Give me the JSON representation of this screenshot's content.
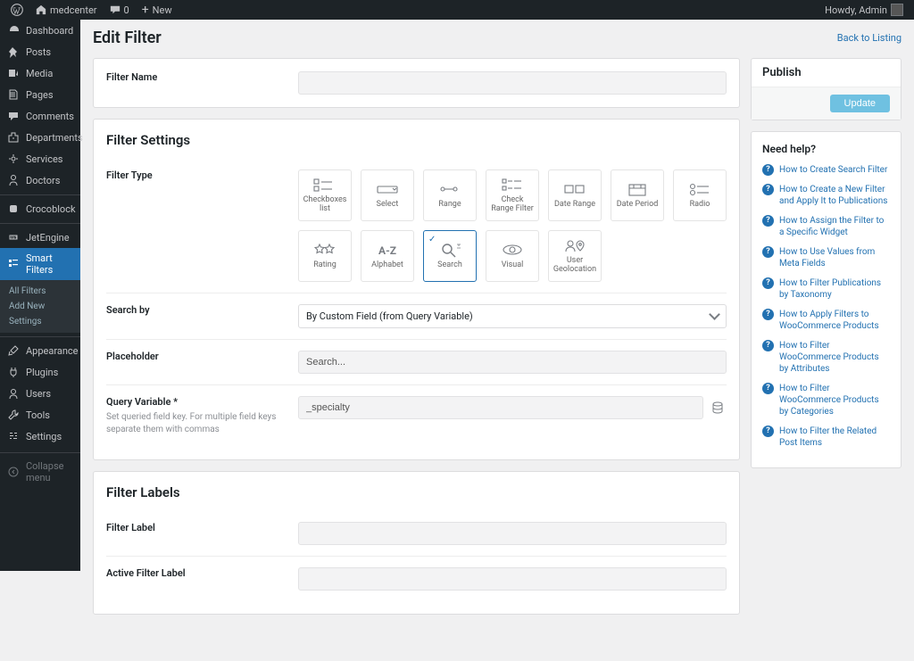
{
  "adminbar": {
    "site_name": "medcenter",
    "comment_count": "0",
    "new_label": "New",
    "howdy": "Howdy, Admin"
  },
  "sidebar": {
    "items": [
      {
        "id": "dashboard",
        "label": "Dashboard",
        "icon": "dash"
      },
      {
        "id": "posts",
        "label": "Posts",
        "icon": "pin"
      },
      {
        "id": "media",
        "label": "Media",
        "icon": "media"
      },
      {
        "id": "pages",
        "label": "Pages",
        "icon": "page"
      },
      {
        "id": "comments",
        "label": "Comments",
        "icon": "comment"
      },
      {
        "id": "departments",
        "label": "Departments",
        "icon": "dept"
      },
      {
        "id": "services",
        "label": "Services",
        "icon": "gear"
      },
      {
        "id": "doctors",
        "label": "Doctors",
        "icon": "doctor"
      },
      {
        "id": "crocoblock",
        "label": "Crocoblock",
        "icon": "croco"
      },
      {
        "id": "jetengine",
        "label": "JetEngine",
        "icon": "jet"
      },
      {
        "id": "smartfilters",
        "label": "Smart Filters",
        "icon": "sf"
      },
      {
        "id": "appearance",
        "label": "Appearance",
        "icon": "brush"
      },
      {
        "id": "plugins",
        "label": "Plugins",
        "icon": "plug"
      },
      {
        "id": "users",
        "label": "Users",
        "icon": "user"
      },
      {
        "id": "tools",
        "label": "Tools",
        "icon": "tool"
      },
      {
        "id": "settings",
        "label": "Settings",
        "icon": "gear2"
      },
      {
        "id": "collapse",
        "label": "Collapse menu",
        "icon": "collapse"
      }
    ],
    "submenu": {
      "all_filters": "All Filters",
      "add_new": "Add New",
      "settings": "Settings"
    }
  },
  "page": {
    "title": "Edit Filter",
    "back": "Back to Listing"
  },
  "filter_name": {
    "label": "Filter Name"
  },
  "settings": {
    "heading": "Filter Settings",
    "filter_type_label": "Filter Type",
    "types": [
      "Checkboxes list",
      "Select",
      "Range",
      "Check Range Filter",
      "Date Range",
      "Date Period",
      "Radio",
      "Rating",
      "Alphabet",
      "Search",
      "Visual",
      "User Geolocation"
    ],
    "selected_type": "Search",
    "search_by_label": "Search by",
    "search_by_value": "By Custom Field (from Query Variable)",
    "placeholder_label": "Placeholder",
    "placeholder_value": "Search...",
    "query_var_label": "Query Variable *",
    "query_var_desc": "Set queried field key. For multiple field keys separate them with commas",
    "query_var_value": "_specialty"
  },
  "labels": {
    "heading": "Filter Labels",
    "filter_label": "Filter Label",
    "active_label": "Active Filter Label"
  },
  "publish": {
    "heading": "Publish",
    "button": "Update"
  },
  "help": {
    "heading": "Need help?",
    "items": [
      "How to Create Search Filter",
      "How to Create a New Filter and Apply It to Publications",
      "How to Assign the Filter to a Specific Widget",
      "How to Use Values from Meta Fields",
      "How to Filter Publications by Taxonomy",
      "How to Apply Filters to WooCommerce Products",
      "How to Filter WooCommerce Products by Attributes",
      "How to Filter WooCommerce Products by Categories",
      "How to Filter the Related Post Items"
    ]
  },
  "icons": {
    "Checkboxes list": "<rect x='2' y='3' width='5' height='5' stroke='currentColor' fill='none'/><line x1='10' y1='6' x2='22' y2='6' stroke='currentColor'/><rect x='2' y='11' width='5' height='5' stroke='currentColor' fill='none'/><line x1='10' y1='14' x2='22' y2='14' stroke='currentColor'/>",
    "Select": "<rect x='3' y='6' width='22' height='7' rx='1' stroke='currentColor' fill='none'/><path d='M20 8 l2 2 l2-2' stroke='currentColor' fill='none'/>",
    "Range": "<circle cx='6' cy='9' r='2' stroke='currentColor' fill='none'/><line x1='8' y1='9' x2='18' y2='9' stroke='currentColor'/><circle cx='20' cy='9' r='2' stroke='currentColor' fill='none'/>",
    "Check Range Filter": "<rect x='3' y='3' width='4' height='4' stroke='currentColor' fill='none'/><line x1='9' y1='5' x2='14' y2='5' stroke='currentColor'/><line x1='16' y1='5' x2='24' y2='5' stroke='currentColor'/><rect x='3' y='11' width='4' height='4' stroke='currentColor' fill='none'/><line x1='9' y1='13' x2='14' y2='13' stroke='currentColor'/><line x1='16' y1='13' x2='24' y2='13' stroke='currentColor'/>",
    "Date Range": "<rect x='3' y='5' width='9' height='8' stroke='currentColor' fill='none'/><rect x='15' y='5' width='9' height='8' stroke='currentColor' fill='none'/>",
    "Date Period": "<rect x='5' y='4' width='18' height='12' stroke='currentColor' fill='none'/><line x1='5' y1='8' x2='23' y2='8' stroke='currentColor'/><line x1='10' y1='4' x2='10' y2='8' stroke='currentColor'/><line x1='18' y1='4' x2='18' y2='8' stroke='currentColor'/>",
    "Radio": "<circle cx='6' cy='6' r='2.5' stroke='currentColor' fill='none'/><line x1='11' y1='6' x2='24' y2='6' stroke='currentColor'/><circle cx='6' cy='13' r='2.5' stroke='currentColor' fill='none'/><line x1='11' y1='13' x2='24' y2='13' stroke='currentColor'/>",
    "Rating": "<path d='M8 3 l1.5 3 3.5 .5 -2.5 2.5 .6 3.5 L8 11 l-3 1.5 .6-3.5 -2.5-2.5 3.5-.5z' stroke='currentColor' fill='none'/><path d='M19 3 l1.5 3 3.5 .5 -2.5 2.5 .6 3.5 L19 11 l-3 1.5 .6-3.5 -2.5-2.5 3.5-.5z' stroke='currentColor' fill='none'/>",
    "Alphabet": "<text x='4' y='14' font-size='12' fill='currentColor' font-weight='bold'>A-Z</text>",
    "Search": "<circle cx='11' cy='8' r='5' stroke='currentColor' fill='none' stroke-width='1.4'/><line x1='15' y1='12' x2='20' y2='17' stroke='currentColor' stroke-width='1.4'/><path d='M22 3 l4 0 M24 3 l0 2 M22 7 l4 0' stroke='currentColor' stroke-width='0.8'/>",
    "Visual": "<ellipse cx='14' cy='9' rx='10' ry='5' stroke='currentColor' fill='none'/><circle cx='14' cy='9' r='3' stroke='currentColor' fill='none'/>",
    "User Geolocation": "<circle cx='9' cy='7' r='3' stroke='currentColor' fill='none'/><path d='M4 16 c0-4 3-5 5-5 s5 1 5 5' stroke='currentColor' fill='none'/><path d='M20 4 c-2 0-4 2-4 4 c0 3 4 7 4 7 s4-4 4-7 c0-2-2-4-4-4z' stroke='currentColor' fill='none'/><circle cx='20' cy='8' r='1.3' stroke='currentColor' fill='none'/>"
  },
  "side_icons": {
    "dash": "<path d='M3 7a5 5 0 0 1 10 0v1H3z M7 4l3 2'/>",
    "pin": "<path d='M6 2l5 5-2 2 1 4-3-3-4 4 1-5-2-2z'/>",
    "media": "<path d='M2 3h7v8H2z M3 9l2-2 2 2 M12 4v6l-2-1'/>",
    "page": "<path d='M3 2h6l2 2v8H3z M3 5h6 M3 7h6 M3 9h6' fill='none' stroke='currentColor'/>",
    "comment": "<path d='M2 3h10v6H7l-3 3V9H2z'/>",
    "dept": "<path d='M2 12V5h3V2h4v3h3v7z M6 8h2' fill='none' stroke='currentColor'/>",
    "gear": "<circle cx='7' cy='7' r='2' fill='none' stroke='currentColor'/><path d='M7 2v2M7 10v2M2 7h2M10 7h2' stroke='currentColor'/>",
    "doctor": "<circle cx='7' cy='4' r='2.5' fill='none' stroke='currentColor'/><path d='M3 13c0-3 2-4 4-4s4 1 4 4' fill='none' stroke='currentColor'/>",
    "croco": "<rect x='3' y='3' width='8' height='8' rx='2' fill='currentColor'/>",
    "jet": "<path d='M3 5h8v4H3z' fill='none' stroke='currentColor'/><text x='4' y='8.5' font-size='4.5' fill='currentColor'>API</text>",
    "sf": "<rect x='2' y='2' width='3' height='3' fill='currentColor'/><rect x='6' y='2' width='6' height='1.2' fill='currentColor'/><rect x='2' y='7' width='3' height='3' fill='currentColor'/><rect x='6' y='7' width='6' height='1.2' fill='currentColor'/>",
    "brush": "<path d='M9 2l3 3-5 5-3-3z M3 8l-1 4 4-1' fill='none' stroke='currentColor'/>",
    "plug": "<path d='M5 2v3M9 2v3M4 5h6v3a3 3 0 0 1-6 0zM7 11v2' fill='none' stroke='currentColor'/>",
    "user": "<circle cx='7' cy='5' r='2.5' fill='none' stroke='currentColor'/><path d='M3 13c0-3 2-4 4-4s4 1 4 4' fill='none' stroke='currentColor'/>",
    "tool": "<path d='M9 2a3 3 0 0 0-3 4L2 10l2 2 4-4a3 3 0 0 0 4-3l-2 2-1-1z' fill='none' stroke='currentColor'/>",
    "gear2": "<rect x='3' y='3' width='3' height='1' fill='currentColor'/><rect x='8' y='3' width='3' height='1' fill='currentColor'/><rect x='3' y='6' width='4' height='1' fill='currentColor'/><rect x='9' y='6' width='2' height='1' fill='currentColor'/><rect x='3' y='9' width='2' height='1' fill='currentColor'/><rect x='7' y='9' width='4' height='1' fill='currentColor'/>",
    "collapse": "<circle cx='7' cy='7' r='5' fill='none' stroke='currentColor'/><path d='M8 5l-2 2 2 2' fill='none' stroke='currentColor'/>"
  }
}
